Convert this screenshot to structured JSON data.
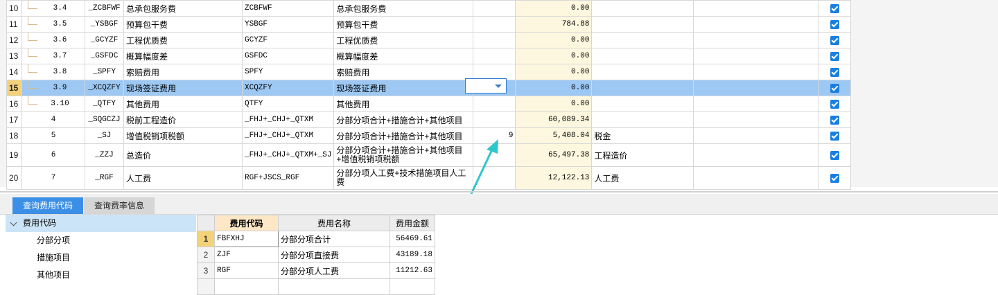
{
  "fee_table": {
    "rows": [
      {
        "n": "10",
        "seq": "3.4",
        "code": "_ZCBFWF",
        "name": "总承包服务费",
        "base": "ZCBFWF",
        "base_desc": "总承包服务费",
        "rate": "",
        "amount": "0.00",
        "remark": "",
        "checked": true,
        "child": true
      },
      {
        "n": "11",
        "seq": "3.5",
        "code": "_YSBGF",
        "name": "预算包干费",
        "base": "YSBGF",
        "base_desc": "预算包干费",
        "rate": "",
        "amount": "784.88",
        "remark": "",
        "checked": true,
        "child": true
      },
      {
        "n": "12",
        "seq": "3.6",
        "code": "_GCYZF",
        "name": "工程优质费",
        "base": "GCYZF",
        "base_desc": "工程优质费",
        "rate": "",
        "amount": "0.00",
        "remark": "",
        "checked": true,
        "child": true
      },
      {
        "n": "13",
        "seq": "3.7",
        "code": "_GSFDC",
        "name": "概算幅度差",
        "base": "GSFDC",
        "base_desc": "概算幅度差",
        "rate": "",
        "amount": "0.00",
        "remark": "",
        "checked": true,
        "child": true
      },
      {
        "n": "14",
        "seq": "3.8",
        "code": "_SPFY",
        "name": "索赔费用",
        "base": "SPFY",
        "base_desc": "索赔费用",
        "rate": "",
        "amount": "0.00",
        "remark": "",
        "checked": true,
        "child": true
      },
      {
        "n": "15",
        "seq": "3.9",
        "code": "_XCQZFY",
        "name": "现场签证费用",
        "base": "XCQZFY",
        "base_desc": "现场签证费用",
        "rate": "",
        "amount": "0.00",
        "remark": "",
        "checked": true,
        "child": true,
        "selected": true
      },
      {
        "n": "16",
        "seq": "3.10",
        "code": "_QTFY",
        "name": "其他费用",
        "base": "QTFY",
        "base_desc": "其他费用",
        "rate": "",
        "amount": "0.00",
        "remark": "",
        "checked": true,
        "child": true
      },
      {
        "n": "17",
        "seq": "4",
        "code": "_SQGCZJ",
        "name": "税前工程造价",
        "base": "_FHJ+_CHJ+_QTXM",
        "base_desc": "分部分项合计+措施合计+其他项目",
        "rate": "",
        "amount": "60,089.34",
        "remark": "",
        "checked": true
      },
      {
        "n": "18",
        "seq": "5",
        "code": "_SJ",
        "name": "增值税销项税额",
        "base": "_FHJ+_CHJ+_QTXM",
        "base_desc": "分部分项合计+措施合计+其他项目",
        "rate": "9",
        "amount": "5,408.04",
        "remark": "税金",
        "checked": true
      },
      {
        "n": "19",
        "seq": "6",
        "code": "_ZZJ",
        "name": "总造价",
        "base": "_FHJ+_CHJ+_QTXM+_SJ",
        "base_desc": "分部分项合计+措施合计+其他项目+增值税销项税额",
        "rate": "",
        "amount": "65,497.38",
        "remark": "工程造价",
        "checked": true,
        "tall": true
      },
      {
        "n": "20",
        "seq": "7",
        "code": "_RGF",
        "name": "人工费",
        "base": "RGF+JSCS_RGF",
        "base_desc": "分部分项人工费+技术措施项目人工费",
        "rate": "",
        "amount": "12,122.13",
        "remark": "人工费",
        "checked": true,
        "tall": true
      }
    ]
  },
  "tabs": {
    "active": "查询费用代码",
    "inactive": "查询费率信息"
  },
  "code_tree": {
    "root": "费用代码",
    "items": [
      "分部分项",
      "措施项目",
      "其他项目"
    ]
  },
  "code_table": {
    "headers": {
      "code": "费用代码",
      "name": "费用名称",
      "amount": "费用金额"
    },
    "rows": [
      {
        "idx": "1",
        "code": "FBFXHJ",
        "name": "分部分项合计",
        "amount": "56469.61"
      },
      {
        "idx": "2",
        "code": "ZJF",
        "name": "分部分项直接费",
        "amount": "43189.18"
      },
      {
        "idx": "3",
        "code": "RGF",
        "name": "分部分项人工费",
        "amount": "11212.63"
      }
    ]
  },
  "colors": {
    "selected_row": "#9dc8f3",
    "amount_bg": "#fdf7df",
    "tab_active": "#3b8fe6",
    "arrow": "#2ec7c9"
  },
  "icons": [
    "checkbox-checked-icon",
    "dropdown-arrow-icon",
    "chevron-down-icon",
    "annotation-arrow"
  ]
}
